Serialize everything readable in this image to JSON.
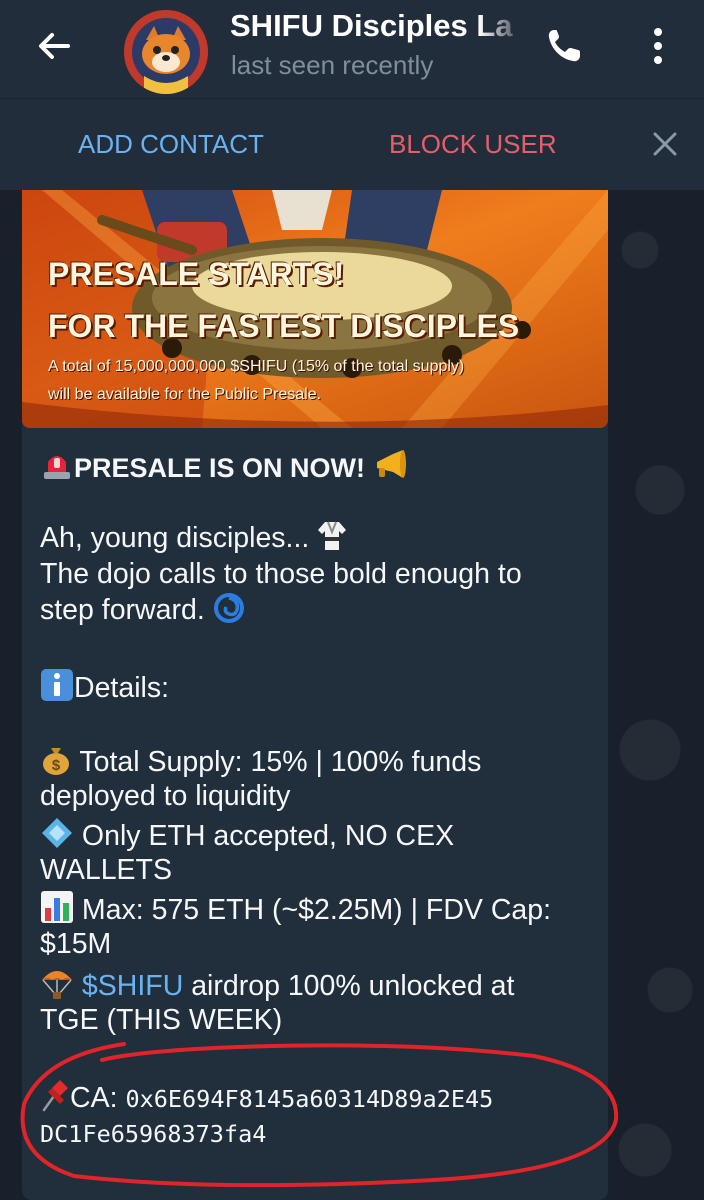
{
  "header": {
    "title": "SHIFU Disciples La",
    "status": "last seen recently",
    "back_icon": "arrow-left-icon",
    "call_icon": "phone-icon",
    "menu_icon": "more-vertical-icon"
  },
  "action_bar": {
    "add_contact": "ADD CONTACT",
    "block_user": "BLOCK USER",
    "close_icon": "close-icon"
  },
  "banner": {
    "title_line1": "PRESALE STARTS!",
    "title_line2": "FOR THE FASTEST DISCIPLES",
    "caption_line1": "A total of 15,000,000,000 $SHIFU (15% of the total supply)",
    "caption_line2": "will be available for the Public Presale."
  },
  "message": {
    "heading": "PRESALE IS ON NOW!",
    "intro_line1": "Ah, young disciples...",
    "intro_line2": "The dojo calls to those bold enough to",
    "intro_line3": "step forward.",
    "details_label": "Details:",
    "supply_line1": "Total Supply: 15% | 100% funds",
    "supply_line2": "deployed to liquidity",
    "eth_line1": "Only ETH accepted, NO CEX",
    "eth_line2": "WALLETS",
    "max_line1": "Max: 575 ETH (~$2.25M) | FDV Cap:",
    "max_line2": "$15M",
    "airdrop_link": "$SHIFU",
    "airdrop_rest": " airdrop 100% unlocked at",
    "airdrop_line2": "TGE (THIS WEEK)",
    "ca_label": "CA: ",
    "ca_part1": "0x6E694F8145a60314D89a2E45",
    "ca_part2": "DC1Fe65968373fa4"
  },
  "colors": {
    "header_bg": "#212d3b",
    "bubble_bg": "#212e3b",
    "link": "#6ab3f3",
    "block_red": "#e55f6b",
    "annotation_red": "#e0242a"
  }
}
